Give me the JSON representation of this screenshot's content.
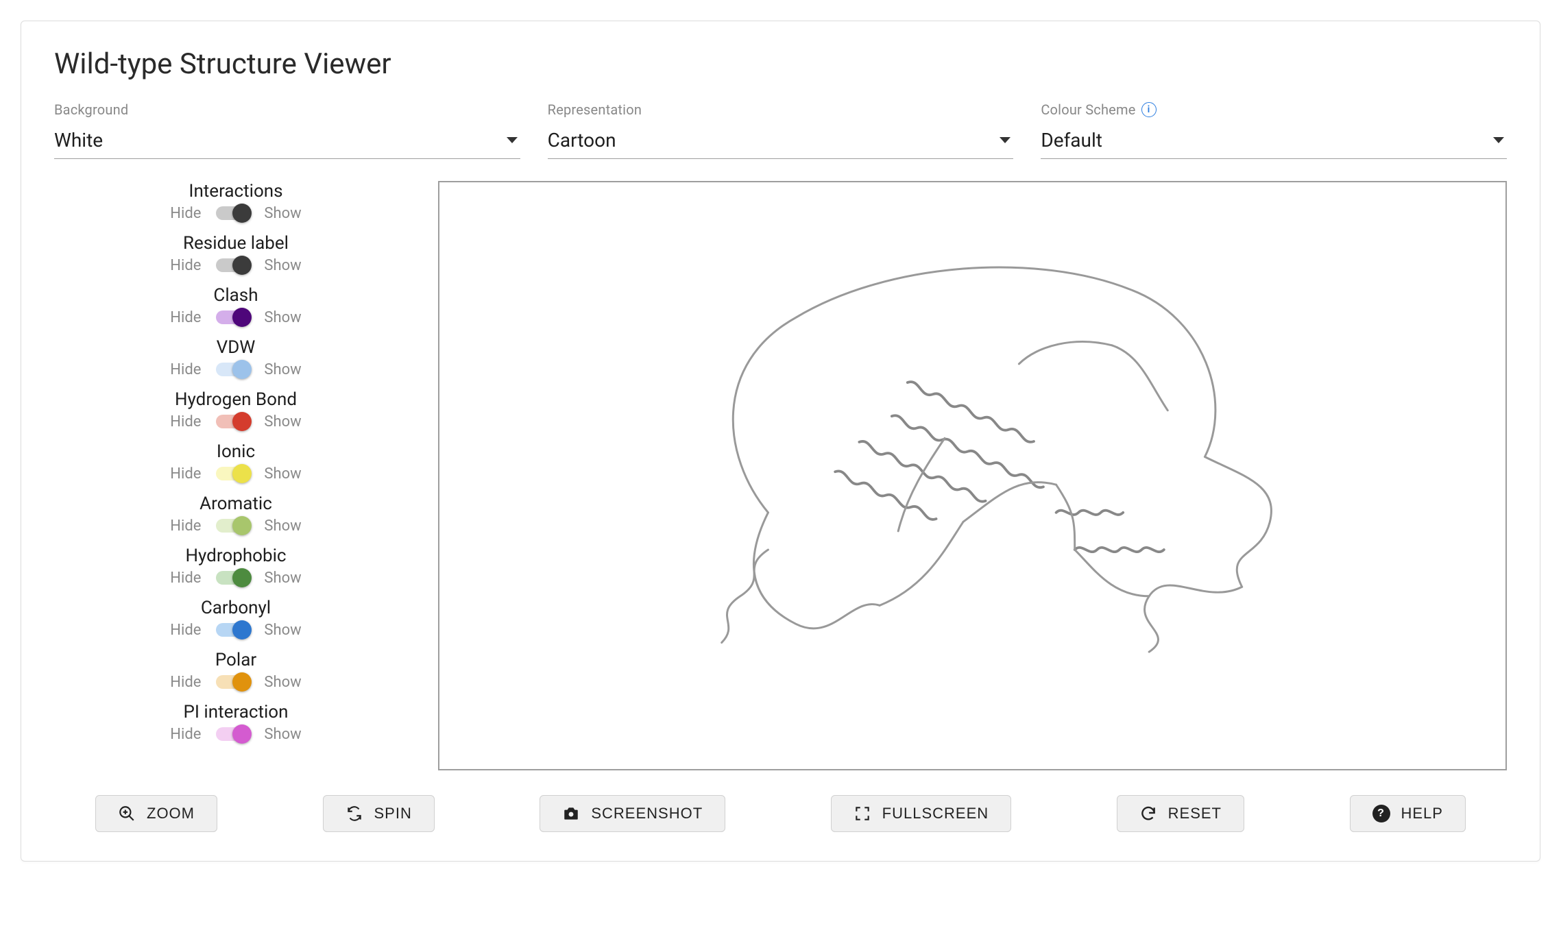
{
  "title": "Wild-type Structure Viewer",
  "selects": {
    "background": {
      "label": "Background",
      "value": "White"
    },
    "representation": {
      "label": "Representation",
      "value": "Cartoon"
    },
    "colour_scheme": {
      "label": "Colour Scheme",
      "value": "Default"
    }
  },
  "toggle_labels": {
    "hide": "Hide",
    "show": "Show"
  },
  "toggles": [
    {
      "name": "Interactions",
      "state": "show",
      "track": "#9e9e9e",
      "thumb": "#3b3b3b"
    },
    {
      "name": "Residue label",
      "state": "show",
      "track": "#9e9e9e",
      "thumb": "#3b3b3b"
    },
    {
      "name": "Clash",
      "state": "show",
      "track": "#b06bd9",
      "thumb": "#4e067a"
    },
    {
      "name": "VDW",
      "state": "show",
      "track": "#b8d4f2",
      "thumb": "#9cc2ea"
    },
    {
      "name": "Hydrogen Bond",
      "state": "show",
      "track": "#e58b7b",
      "thumb": "#d43c2d"
    },
    {
      "name": "Ionic",
      "state": "show",
      "track": "#f6f08a",
      "thumb": "#ece14a"
    },
    {
      "name": "Aromatic",
      "state": "show",
      "track": "#cbe0a3",
      "thumb": "#a8c66c"
    },
    {
      "name": "Hydrophobic",
      "state": "show",
      "track": "#9acb8e",
      "thumb": "#4d8b3f"
    },
    {
      "name": "Carbonyl",
      "state": "show",
      "track": "#7bb4eb",
      "thumb": "#2d77cf"
    },
    {
      "name": "Polar",
      "state": "show",
      "track": "#f0c77a",
      "thumb": "#e0920d"
    },
    {
      "name": "PI interaction",
      "state": "show",
      "track": "#e9a7e7",
      "thumb": "#d45bd0"
    }
  ],
  "buttons": {
    "zoom": "ZOOM",
    "spin": "SPIN",
    "screenshot": "SCREENSHOT",
    "fullscreen": "FULLSCREEN",
    "reset": "RESET",
    "help": "HELP"
  }
}
